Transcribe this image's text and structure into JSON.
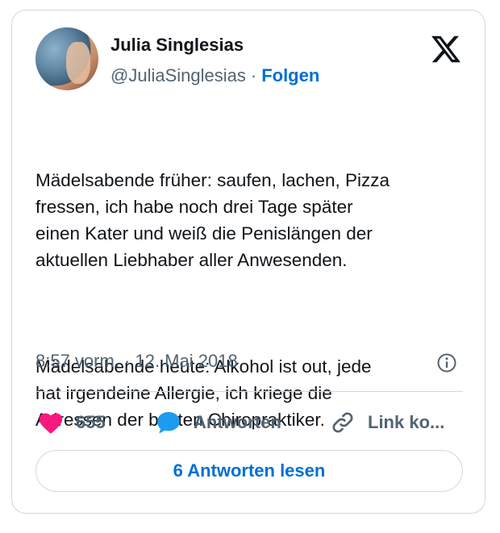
{
  "tweet": {
    "author_name": "Julia Singlesias",
    "handle": "@JuliaSinglesias",
    "separator": "·",
    "follow_label": "Folgen",
    "text_paragraph_1": "Mädelsabende früher: saufen, lachen, Pizza\nfressen, ich habe noch drei Tage später\neinen Kater und weiß die Penislängen der\naktuellen Liebhaber aller Anwesenden.",
    "text_paragraph_2": "Mädelsabende heute: Alkohol ist out, jede\nhat irgendeine Allergie, ich kriege die\nAdressen der besten Chiropraktiker.",
    "timestamp": "8:57 vorm. · 12. Mai 2018"
  },
  "actions": {
    "like_count": "655",
    "reply_label": "Antworten",
    "copy_link_label": "Link ko..."
  },
  "read_replies_label": "6 Antworten lesen",
  "icons": {
    "brand": "x-logo-icon",
    "info": "info-icon",
    "like": "heart-icon",
    "reply": "speech-bubble-icon",
    "link": "link-icon"
  },
  "colors": {
    "accent": "#006fd6",
    "like": "#f91880",
    "reply": "#1d9bf0",
    "secondary_text": "#536471",
    "border": "#cfd9de"
  }
}
